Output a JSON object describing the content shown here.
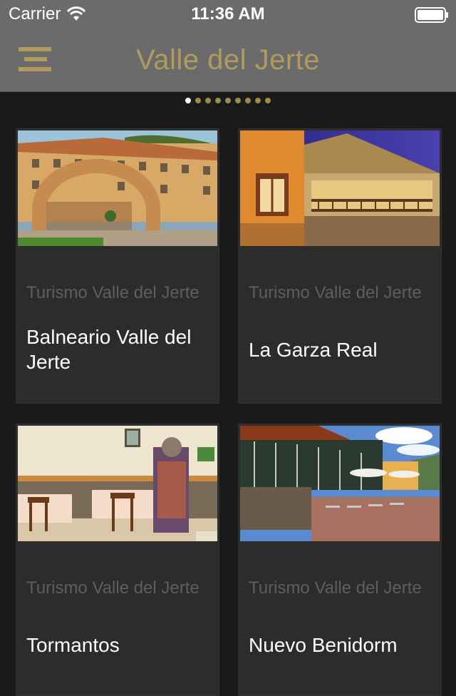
{
  "status_bar": {
    "carrier": "Carrier",
    "time": "11:36 AM"
  },
  "nav": {
    "title": "Valle del Jerte",
    "menu_icon": "menu-icon"
  },
  "pager": {
    "count": 9,
    "active_index": 0
  },
  "cards": [
    {
      "source": "Turismo Valle del Jerte",
      "title": "Balneario Valle del Jerte",
      "image": "hotel-building-photo"
    },
    {
      "source": "Turismo Valle del Jerte",
      "title": "La Garza Real",
      "image": "house-balcony-night-photo"
    },
    {
      "source": "Turismo Valle del Jerte",
      "title": "Tormantos",
      "image": "restaurant-interior-photo"
    },
    {
      "source": "Turismo Valle del Jerte",
      "title": "Nuevo Benidorm",
      "image": "terrace-restaurant-photo"
    }
  ],
  "colors": {
    "accent": "#b09a5e",
    "nav_background": "#6b6b6b",
    "page_background": "#1a1a1a",
    "card_background": "#2c2c2c"
  }
}
